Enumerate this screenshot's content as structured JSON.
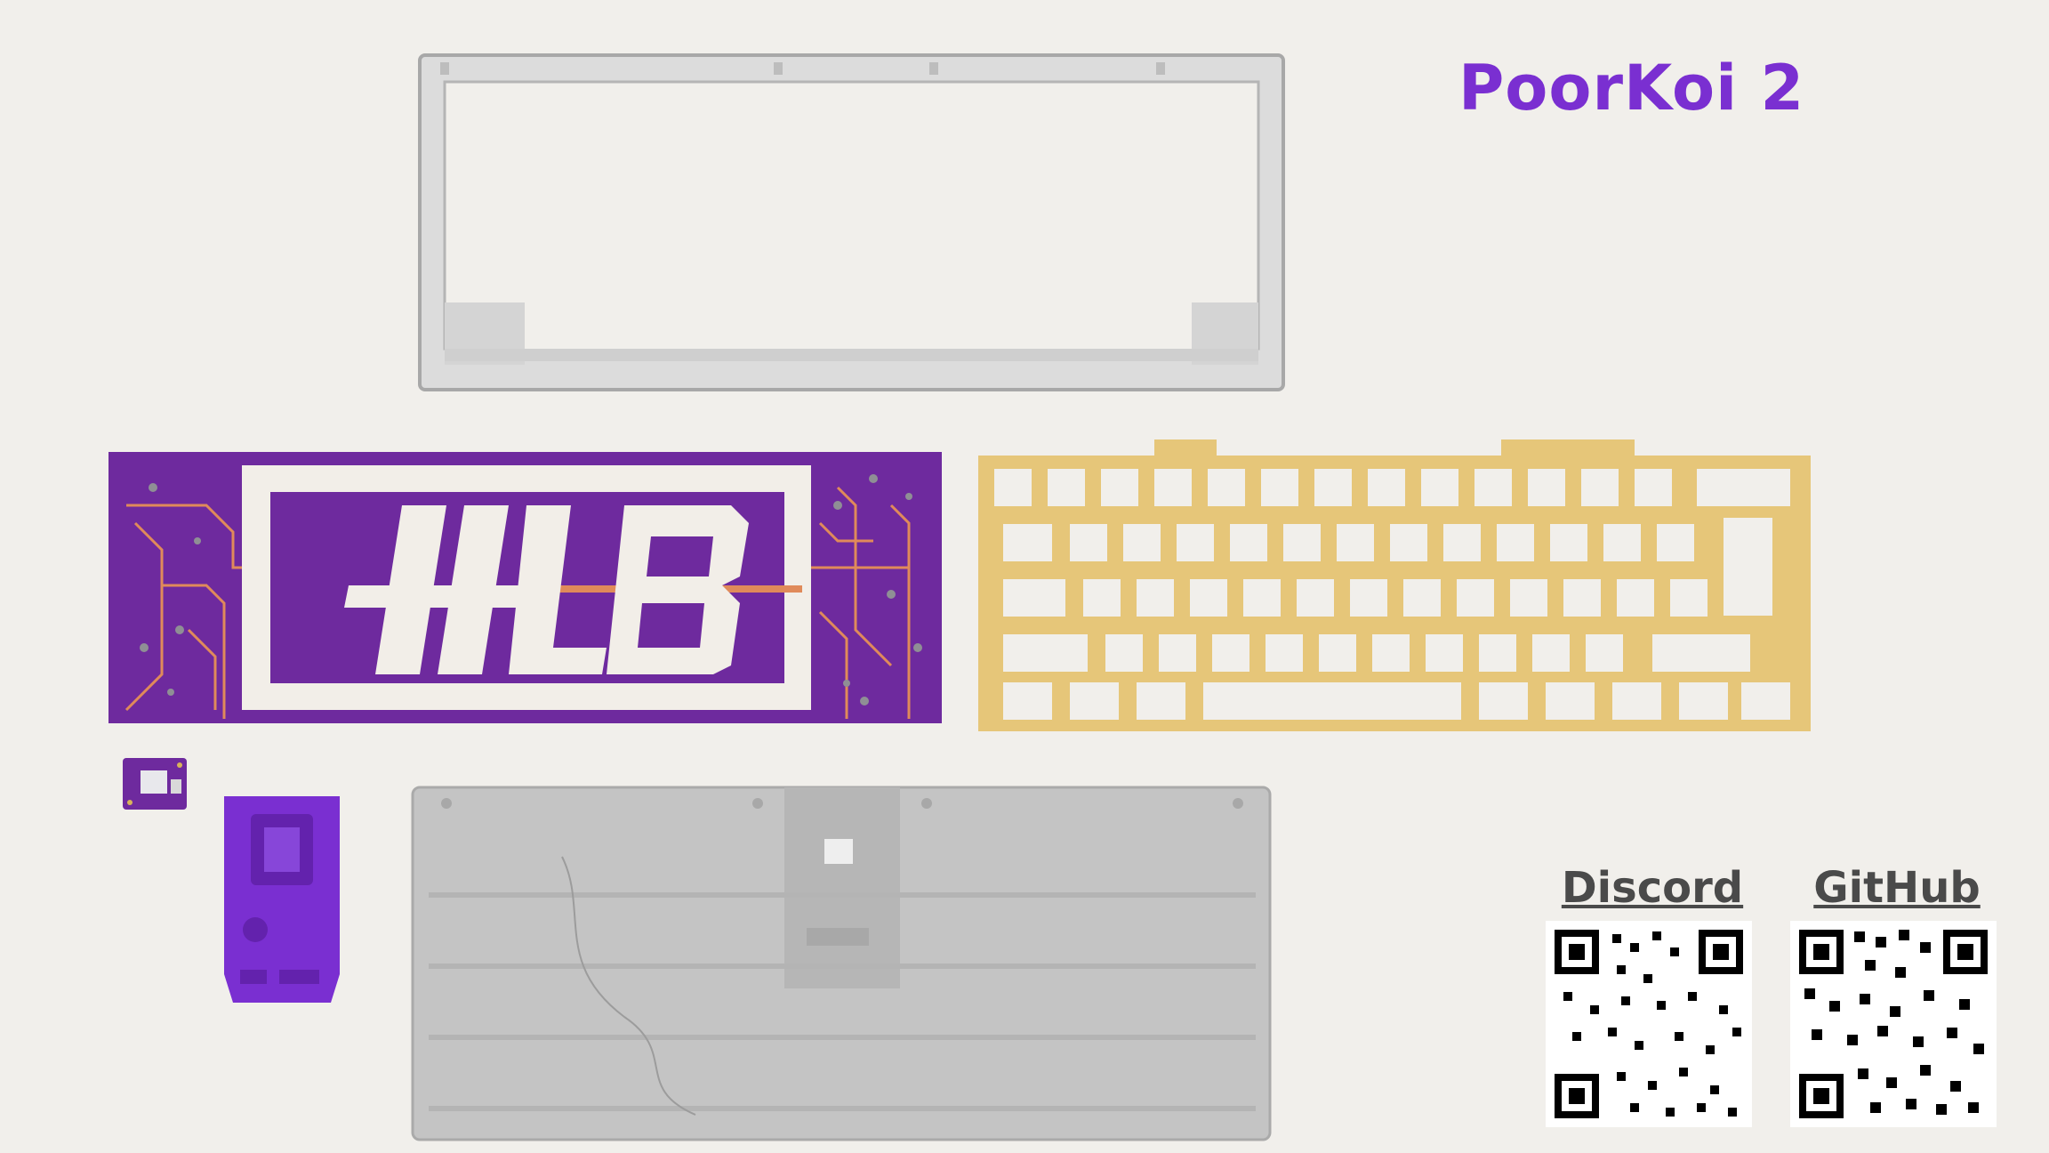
{
  "title": "PoorKoi 2",
  "links": [
    {
      "label": "Discord"
    },
    {
      "label": "GitHub"
    }
  ],
  "colors": {
    "accent": "#7a2fd1",
    "pcb": "#6e2a9e",
    "brass": "#e6c679",
    "case": "#c9c9c9"
  },
  "parts": [
    {
      "name": "top-case-frame"
    },
    {
      "name": "pcb"
    },
    {
      "name": "brass-plate"
    },
    {
      "name": "bottom-case"
    },
    {
      "name": "daughterboard"
    },
    {
      "name": "usb-mount"
    }
  ]
}
